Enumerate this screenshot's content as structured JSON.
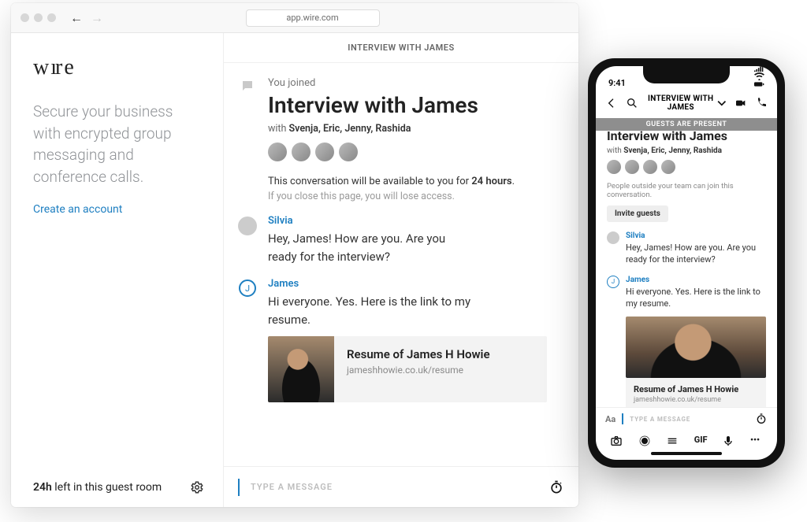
{
  "browser": {
    "url": "app.wire.com"
  },
  "sidebar": {
    "logo": "wire",
    "tagline": "Secure your business with encrypted group messaging and conference calls.",
    "create_link": "Create an account",
    "guest_duration": "24h",
    "guest_suffix": " left in this guest room"
  },
  "conversation": {
    "title_upper": "INTERVIEW WITH JAMES",
    "joined_label": "You joined",
    "name": "Interview with James",
    "with_prefix": "with ",
    "participants": "Svenja, Eric, Jenny, Rashida",
    "availability_prefix": "This conversation will be available to you for ",
    "availability_duration": "24 hours",
    "availability_suffix": ".",
    "close_note": "If you close this page, you will lose access.",
    "compose_placeholder": "TYPE A MESSAGE"
  },
  "messages": [
    {
      "sender": "Silvia",
      "text": "Hey, James! How are you. Are you ready for the interview?"
    },
    {
      "sender": "James",
      "text": "Hi everyone. Yes. Here is the link to my resume."
    }
  ],
  "link_preview": {
    "title": "Resume of James H Howie",
    "url": "jameshhowie.co.uk/resume"
  },
  "phone": {
    "time": "9:41",
    "banner": "GUESTS ARE PRESENT",
    "title_cut": "Interview with James",
    "note": "People outside your team can join this conversation.",
    "invite_button": "Invite guests",
    "tool_gif": "GIF",
    "tool_more": "•••"
  }
}
